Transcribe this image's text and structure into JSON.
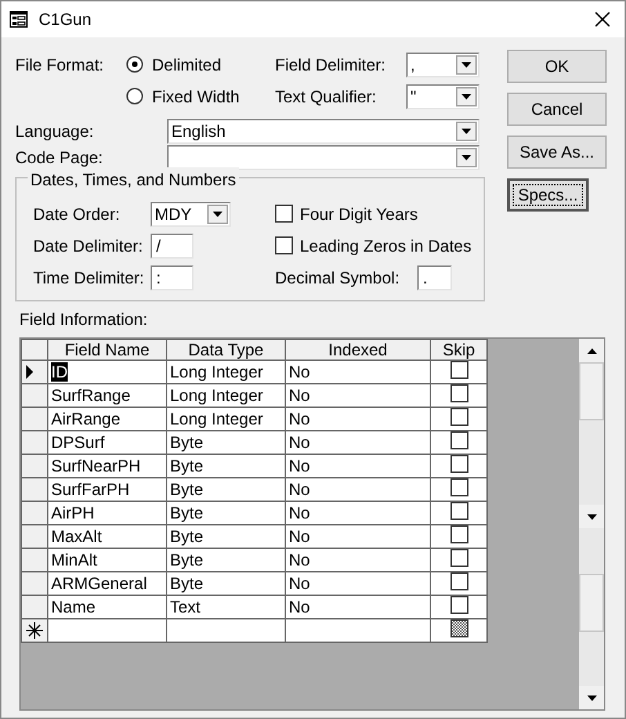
{
  "window": {
    "title": "C1Gun"
  },
  "file_format": {
    "label": "File Format:",
    "options": [
      {
        "label": "Delimited",
        "selected": true
      },
      {
        "label": "Fixed Width",
        "selected": false
      }
    ]
  },
  "field_delimiter": {
    "label": "Field Delimiter:",
    "value": ","
  },
  "text_qualifier": {
    "label": "Text Qualifier:",
    "value": "\""
  },
  "language": {
    "label": "Language:",
    "value": "English"
  },
  "code_page": {
    "label": "Code Page:"
  },
  "dates_group": {
    "title": "Dates, Times, and Numbers",
    "date_order": {
      "label": "Date Order:",
      "value": "MDY"
    },
    "date_delimiter": {
      "label": "Date Delimiter:",
      "value": "/"
    },
    "time_delimiter": {
      "label": "Time Delimiter:",
      "value": ":"
    },
    "four_digit_years": {
      "label": "Four Digit Years",
      "checked": false
    },
    "leading_zeros": {
      "label": "Leading Zeros in Dates",
      "checked": false
    },
    "decimal_symbol": {
      "label": "Decimal Symbol:",
      "value": "."
    }
  },
  "buttons": [
    {
      "label": "OK",
      "focused": false
    },
    {
      "label": "Cancel",
      "focused": false
    },
    {
      "label": "Save As...",
      "focused": false
    },
    {
      "label": "Specs...",
      "focused": true
    }
  ],
  "field_information": {
    "label": "Field Information:",
    "columns": [
      "Field Name",
      "Data Type",
      "Indexed",
      "Skip"
    ],
    "new_row": {
      "skip_disabled": true
    },
    "rows": [
      {
        "field_name": "ID",
        "data_type": "Long Integer",
        "indexed": "No",
        "skip": false,
        "current": true
      },
      {
        "field_name": "SurfRange",
        "data_type": "Long Integer",
        "indexed": "No",
        "skip": false,
        "current": false
      },
      {
        "field_name": "AirRange",
        "data_type": "Long Integer",
        "indexed": "No",
        "skip": false,
        "current": false
      },
      {
        "field_name": "DPSurf",
        "data_type": "Byte",
        "indexed": "No",
        "skip": false,
        "current": false
      },
      {
        "field_name": "SurfNearPH",
        "data_type": "Byte",
        "indexed": "No",
        "skip": false,
        "current": false
      },
      {
        "field_name": "SurfFarPH",
        "data_type": "Byte",
        "indexed": "No",
        "skip": false,
        "current": false
      },
      {
        "field_name": "AirPH",
        "data_type": "Byte",
        "indexed": "No",
        "skip": false,
        "current": false
      },
      {
        "field_name": "MaxAlt",
        "data_type": "Byte",
        "indexed": "No",
        "skip": false,
        "current": false
      },
      {
        "field_name": "MinAlt",
        "data_type": "Byte",
        "indexed": "No",
        "skip": false,
        "current": false
      },
      {
        "field_name": "ARMGeneral",
        "data_type": "Byte",
        "indexed": "No",
        "skip": false,
        "current": false
      },
      {
        "field_name": "Name",
        "data_type": "Text",
        "indexed": "No",
        "skip": false,
        "current": false
      }
    ]
  }
}
